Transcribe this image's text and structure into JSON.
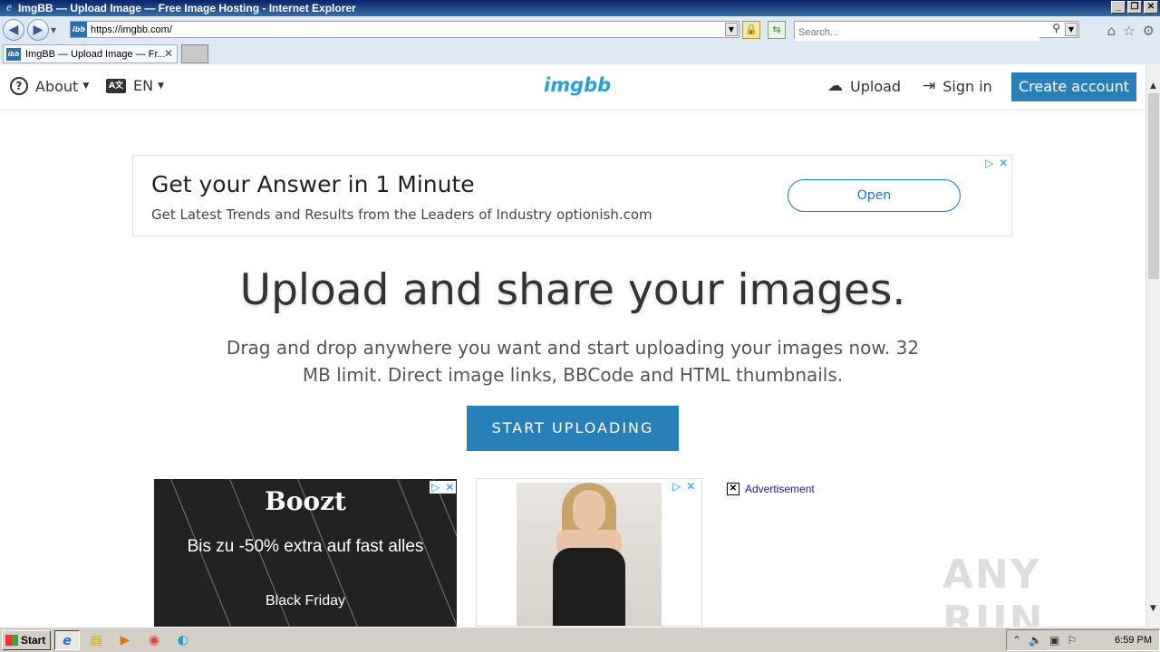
{
  "window": {
    "title": "ImgBB — Upload Image — Free Image Hosting - Internet Explorer",
    "buttons": [
      "_",
      "❐",
      "✕"
    ]
  },
  "addressbar": {
    "url": "https://imgbb.com/",
    "search_placeholder": "Search..."
  },
  "tabs": [
    {
      "label": "ImgBB — Upload Image — Fr...",
      "favicon": "ibb"
    }
  ],
  "header": {
    "about": "About",
    "lang_icon": "A文",
    "lang": "EN",
    "logo": "imgbb",
    "upload": "Upload",
    "signin": "Sign in",
    "create_account": "Create account"
  },
  "top_ad": {
    "headline": "Get your Answer in 1 Minute",
    "subline": "Get Latest Trends and Results from the Leaders of Industry optionish.com",
    "button": "Open"
  },
  "hero": {
    "title": "Upload and share your images.",
    "subtitle": "Drag and drop anywhere you want and start uploading your images now. 32 MB limit. Direct image links, BBCode and HTML thumbnails.",
    "cta": "START UPLOADING"
  },
  "boozt_ad": {
    "brand": "Boozt",
    "offer": "Bis zu -50% extra auf fast alles",
    "tagline": "Black Friday"
  },
  "ad_label": "Advertisement",
  "watermark": "ANY RUN",
  "taskbar": {
    "start": "Start",
    "clock": "6:59 PM"
  },
  "colors": {
    "accent": "#2980b9",
    "logo": "#2a9fd8",
    "ad_blue": "#1a73e8"
  }
}
